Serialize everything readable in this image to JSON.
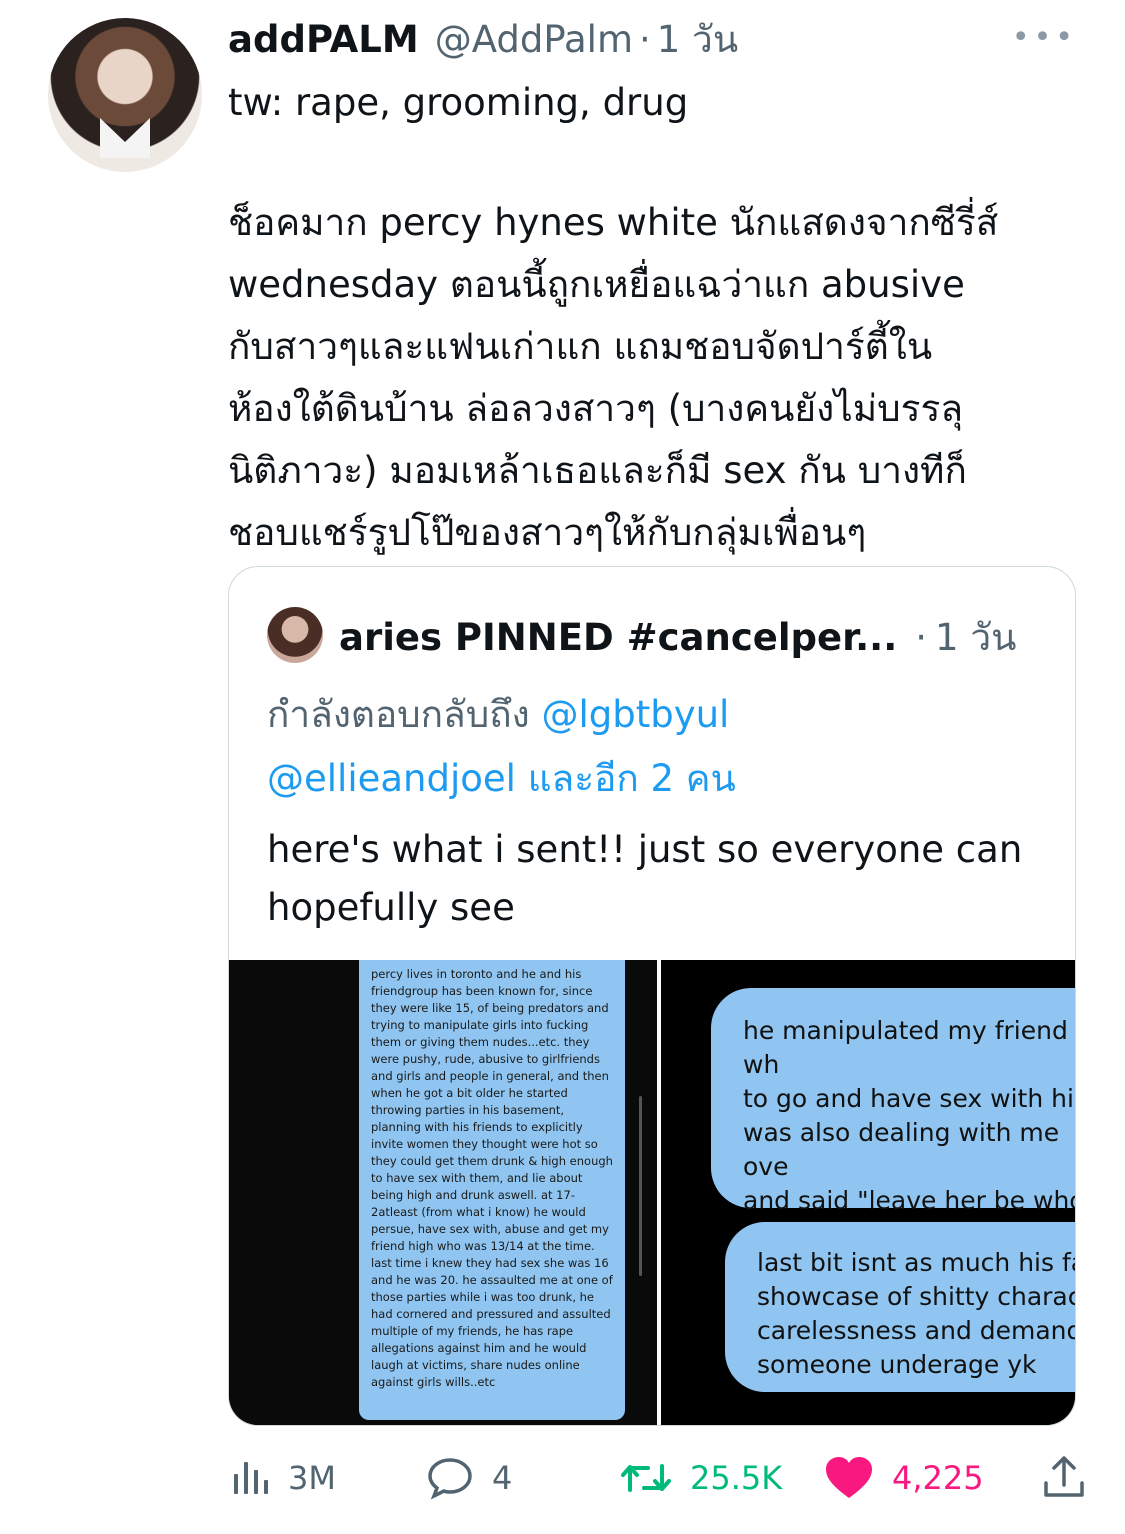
{
  "tweet": {
    "name": "addPALM",
    "handle": "@AddPalm",
    "separator": "·",
    "time": "1 วัน",
    "more": "•••",
    "text_line1": "tw: rape, grooming, drug",
    "text_main": "ช็อคมาก percy hynes white นักแสดงจากซีรี่ส์\nwednesday ตอนนี้ถูกเหยื่อแฉว่าแก abusive\nกับสาวๆและแฟนเก่าแก แถมชอบจัดปาร์ตี้ใน\nห้องใต้ดินบ้าน ล่อลวงสาวๆ (บางคนยังไม่บรรลุ\nนิติภาวะ) มอมเหล้าเธอและก็มี sex กัน บางทีก็\nชอบแชร์รูปโป๊ของสาวๆให้กับกลุ่มเพื่อนๆ"
  },
  "quote": {
    "name": "aries PINNED #cancelper...",
    "separator": "·",
    "time": "1 วัน",
    "reply_prefix": "กำลังตอบกลับถึง",
    "mention1": "@lgbtbyul",
    "mention2": "@ellieandjoel",
    "reply_suffix": "และอีก 2 คน",
    "body": "here's what i sent!! just so everyone can hopefully see",
    "image_left_text": "percy lives in toronto and he and his friendgroup has been known for, since they were like 15, of being predators and trying to manipulate girls into fucking them or giving them nudes...etc. they were pushy, rude, abusive to girlfriends and girls and people in general, and then when he got a bit older he started throwing parties in his basement, planning with his friends to explicitly invite women they thought were hot so they could get them drunk & high enough to have sex with them, and lie about being high and drunk aswell. at 17-2atleast (from what i know) he would persue, have sex with, abuse and get my friend high who was 13/14 at the time. last time i knew they had sex she was 16 and he was 20. he assaulted me at one of those parties while i was too drunk, he had cornered and pressured and assulted multiple of my friends, he has rape allegations against him and he would laugh at victims, share nudes online against girls wills..etc",
    "image_right_bubble1": "he manipulated my friend wh\nto go and have sex with him \nwas also dealing with me ove\nand said \"leave her be who c\nfuck\" n she did lolol",
    "image_right_bubble2": "last bit isnt as much his fau\nshowcase of shitty charact\ncarelessness and demandir\nsomeone underage yk"
  },
  "actions": {
    "views": "3M",
    "replies": "4",
    "retweets": "25.5K",
    "likes": "4,225"
  },
  "colors": {
    "retweet": "#00ba7c",
    "like": "#f91880",
    "link": "#1d9bf0",
    "muted": "#536471",
    "bubble": "#8fc5f0"
  }
}
